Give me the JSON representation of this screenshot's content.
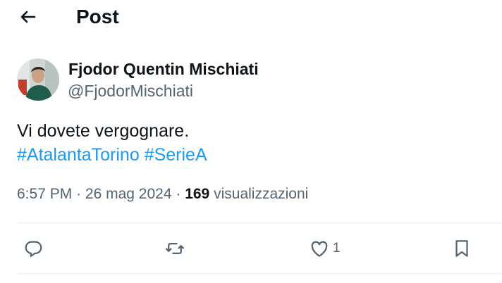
{
  "header": {
    "title": "Post",
    "back_icon": "arrow-left-icon"
  },
  "author": {
    "name": "Fjodor Quentin Mischiati",
    "handle": "@FjodorMischiati"
  },
  "post": {
    "text": "Vi dovete vergognare.",
    "hashtags": [
      "#AtalantaTorino",
      "#SerieA"
    ],
    "time": "6:57 PM",
    "date": "26 mag 2024",
    "separator": "·",
    "views_count": "169",
    "views_label": "visualizzazioni"
  },
  "actions": {
    "reply": {
      "icon": "reply-icon"
    },
    "repost": {
      "icon": "repost-icon"
    },
    "like": {
      "icon": "heart-icon",
      "count": "1"
    },
    "bookmark": {
      "icon": "bookmark-icon"
    }
  },
  "colors": {
    "link": "#1d9bf0",
    "secondary": "#536471",
    "text": "#0f1419",
    "divider": "#e6ecf0"
  }
}
